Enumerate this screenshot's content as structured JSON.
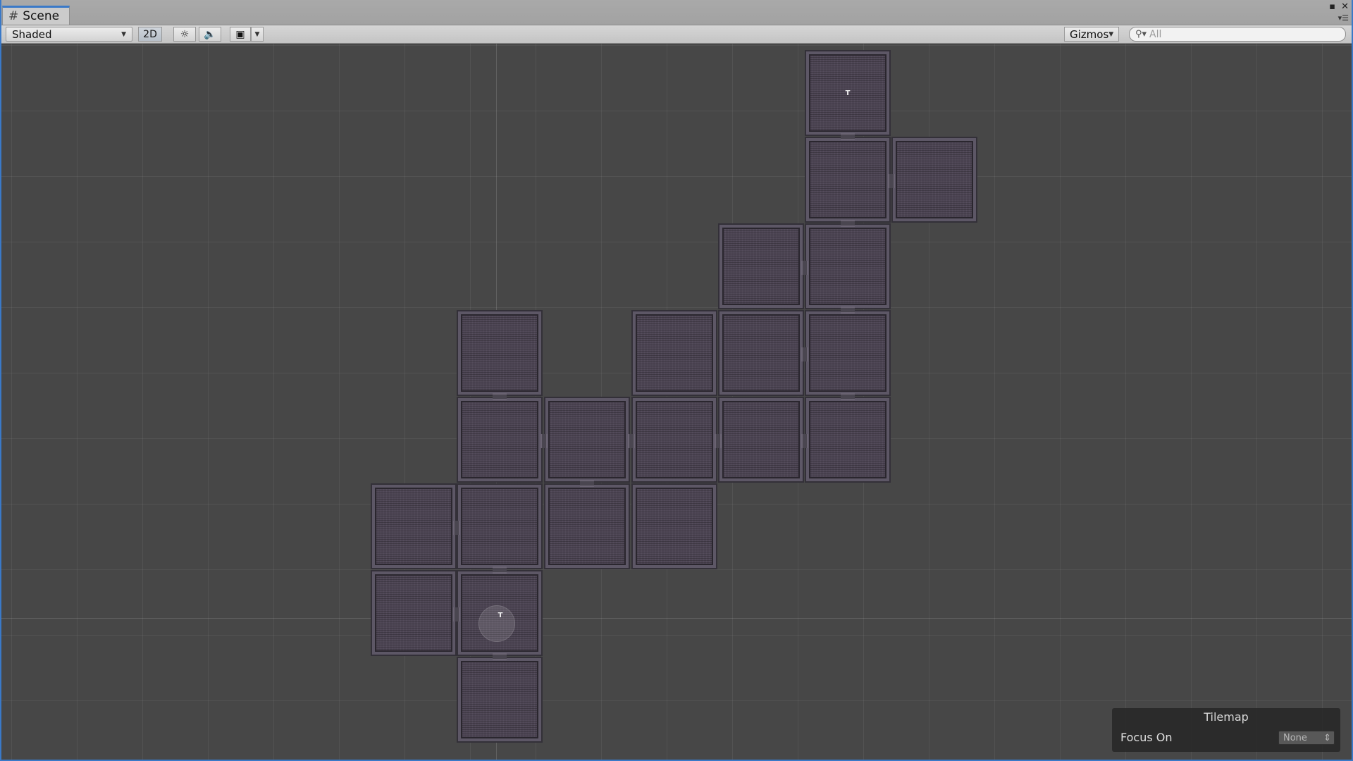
{
  "tab": {
    "title": "Scene",
    "icon": "grid-hash-icon"
  },
  "window_controls": {
    "maximize": "▪",
    "close": "✕"
  },
  "toolbar": {
    "shading_mode": "Shaded",
    "mode_2d": "2D",
    "gizmos": "Gizmos",
    "search_placeholder": "All"
  },
  "tilemap_panel": {
    "title": "Tilemap",
    "focus_label": "Focus On",
    "focus_value": "None"
  },
  "colors": {
    "accent": "#3a79c8",
    "viewport_bg": "#474747",
    "room_fill": "#4e4655"
  }
}
